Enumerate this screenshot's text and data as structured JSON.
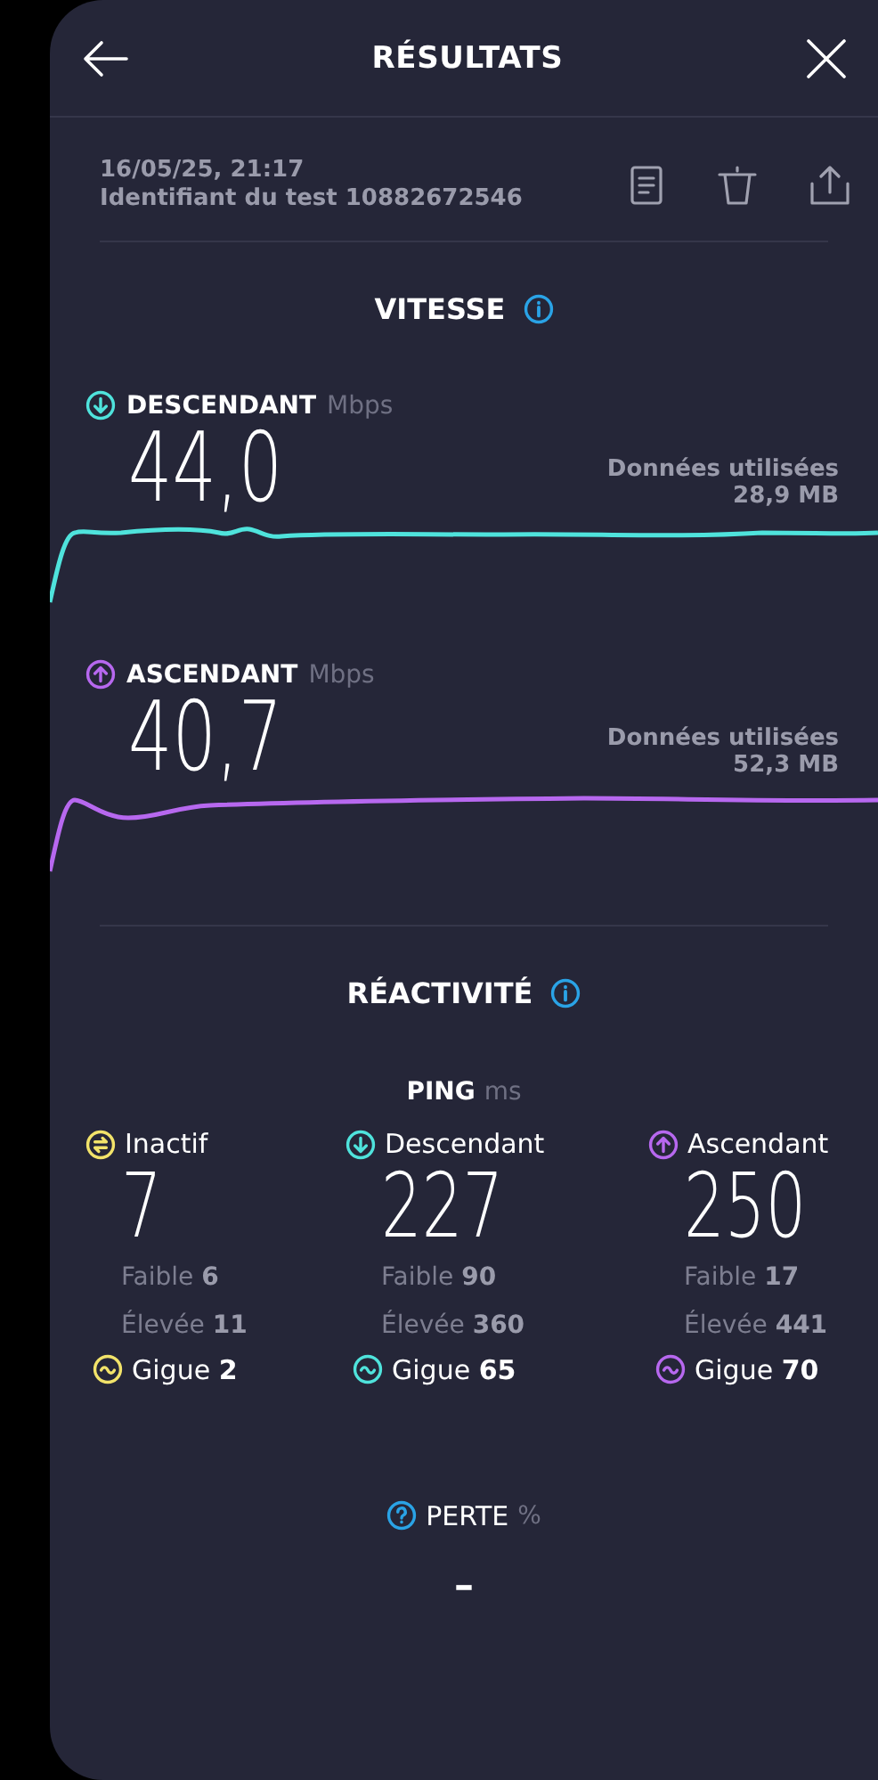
{
  "header": {
    "title": "RÉSULTATS"
  },
  "test": {
    "date": "16/05/25, 21:17",
    "id": "Identifiant du test 10882672546"
  },
  "speed": {
    "title": "VITESSE",
    "results": [
      {
        "kind": "download",
        "label": "DESCENDANT",
        "unit": "Mbps",
        "value": "44,0",
        "data_label": "Données utilisées",
        "data_value": "28,9 MB",
        "color": "#4fe3dc"
      },
      {
        "kind": "upload",
        "label": "ASCENDANT",
        "unit": "Mbps",
        "value": "40,7",
        "data_label": "Données utilisées",
        "data_value": "52,3 MB",
        "color": "#b768ef"
      }
    ]
  },
  "responsiveness": {
    "title": "RÉACTIVITÉ",
    "ping": {
      "label": "PING",
      "unit": "ms",
      "columns": [
        {
          "kind": "idle",
          "label": "Inactif",
          "value": "7",
          "low_label": "Faible",
          "low": "6",
          "high_label": "Élevée",
          "high": "11",
          "jitter_label": "Gigue",
          "jitter": "2",
          "color": "#f2e36a"
        },
        {
          "kind": "download",
          "label": "Descendant",
          "value": "227",
          "low_label": "Faible",
          "low": "90",
          "high_label": "Élevée",
          "high": "360",
          "jitter_label": "Gigue",
          "jitter": "65",
          "color": "#4fe3dc"
        },
        {
          "kind": "upload",
          "label": "Ascendant",
          "value": "250",
          "low_label": "Faible",
          "low": "17",
          "high_label": "Élevée",
          "high": "441",
          "jitter_label": "Gigue",
          "jitter": "70",
          "color": "#b768ef"
        }
      ]
    }
  },
  "loss": {
    "label": "PERTE",
    "unit": "%",
    "value": "–"
  }
}
